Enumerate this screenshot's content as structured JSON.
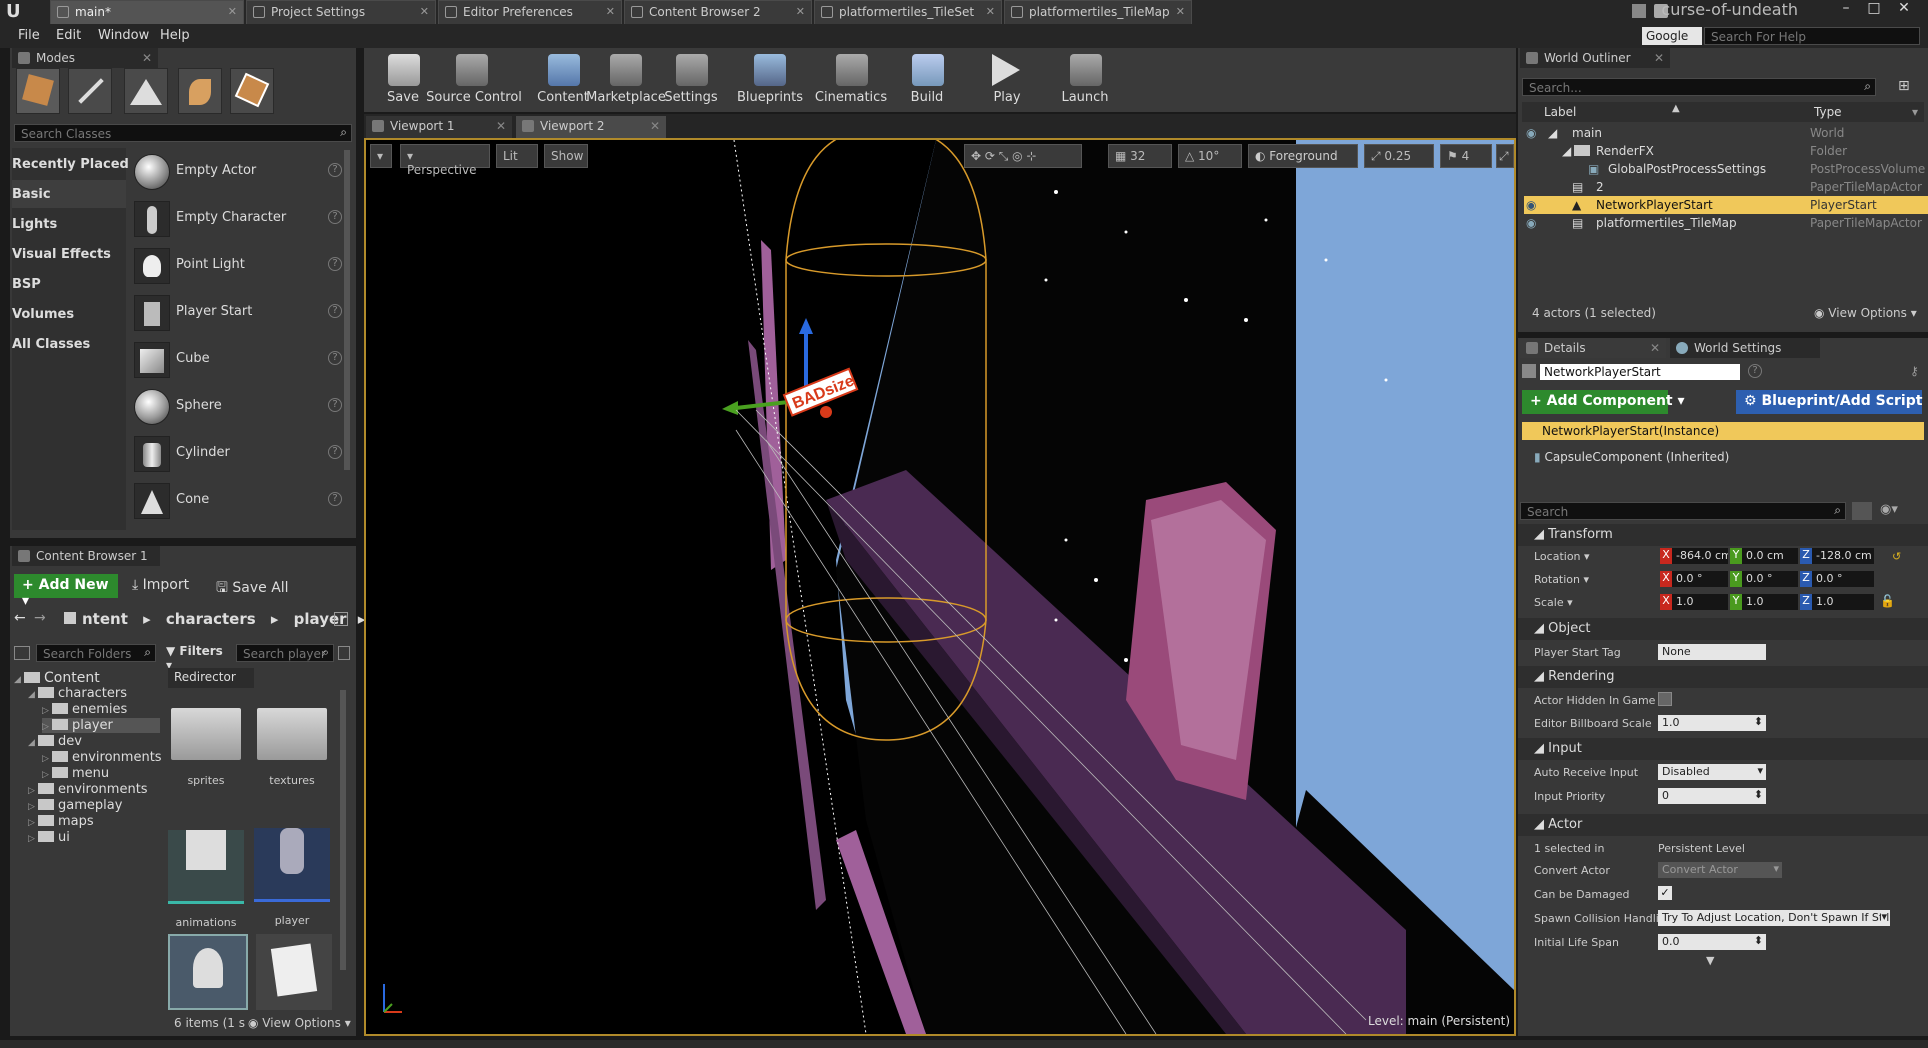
{
  "titlebar": {
    "tabs": [
      "main*",
      "Project Settings",
      "Editor Preferences",
      "Content Browser 2",
      "platformertiles_TileSet",
      "platformertiles_TileMap"
    ],
    "project_name": "curse-of-undeath"
  },
  "menubar": {
    "items": [
      "File",
      "Edit",
      "Window",
      "Help"
    ],
    "search_provider": "Google",
    "search_placeholder": "Search For Help"
  },
  "modes": {
    "panel_title": "Modes",
    "search_placeholder": "Search Classes",
    "categories": [
      "Recently Placed",
      "Basic",
      "Lights",
      "Visual Effects",
      "BSP",
      "Volumes",
      "All Classes"
    ],
    "classes": [
      "Empty Actor",
      "Empty Character",
      "Point Light",
      "Player Start",
      "Cube",
      "Sphere",
      "Cylinder",
      "Cone"
    ]
  },
  "toolbar": {
    "items": [
      "Save",
      "Source Control",
      "Content",
      "Marketplace",
      "Settings",
      "Blueprints",
      "Cinematics",
      "Build",
      "Play",
      "Launch"
    ]
  },
  "viewport": {
    "tabs": [
      "Viewport 1",
      "Viewport 2"
    ],
    "perspective": "Perspective",
    "lit": "Lit",
    "show": "Show",
    "grid_size": "32",
    "rotation_snap": "10°",
    "layer": "Foreground",
    "scale_snap": "0.25",
    "camera_speed": "4",
    "level_label": "Level:",
    "level_name": "main (Persistent)",
    "widget_label": "BADsize"
  },
  "content_browser": {
    "panel_title": "Content Browser 1",
    "add_new": "Add New",
    "import": "Import",
    "save_all": "Save All",
    "path": [
      "ntent",
      "characters",
      "player"
    ],
    "search_folders_placeholder": "Search Folders",
    "filters": "Filters",
    "search_placeholder": "Search player",
    "filter_chip": "Redirector",
    "tree": [
      {
        "label": "Content",
        "level": 0
      },
      {
        "label": "characters",
        "level": 1
      },
      {
        "label": "enemies",
        "level": 2
      },
      {
        "label": "player",
        "level": 2
      },
      {
        "label": "dev",
        "level": 1
      },
      {
        "label": "environments",
        "level": 2
      },
      {
        "label": "menu",
        "level": 2
      },
      {
        "label": "environments",
        "level": 1
      },
      {
        "label": "gameplay",
        "level": 1
      },
      {
        "label": "maps",
        "level": 1
      },
      {
        "label": "ui",
        "level": 1
      }
    ],
    "assets": [
      "sprites",
      "textures",
      "animations",
      "player"
    ],
    "item_count": "6 items (1 s",
    "view_options": "View Options"
  },
  "outliner": {
    "panel_title": "World Outliner",
    "search_placeholder": "Search...",
    "col_label": "Label",
    "col_type": "Type",
    "rows": [
      {
        "label": "main",
        "type": "World"
      },
      {
        "label": "RenderFX",
        "type": "Folder"
      },
      {
        "label": "GlobalPostProcessSettings",
        "type": "PostProcessVolume"
      },
      {
        "label": "2",
        "type": "PaperTileMapActor"
      },
      {
        "label": "NetworkPlayerStart",
        "type": "PlayerStart"
      },
      {
        "label": "platformertiles_TileMap",
        "type": "PaperTileMapActor"
      }
    ],
    "footer": "4 actors (1 selected)",
    "view_options": "View Options"
  },
  "details": {
    "tabs": [
      "Details",
      "World Settings"
    ],
    "actor_name": "NetworkPlayerStart",
    "add_component": "Add Component",
    "blueprint": "Blueprint/Add Script",
    "components": [
      "NetworkPlayerStart(Instance)",
      "CapsuleComponent (Inherited)"
    ],
    "search_placeholder": "Search",
    "sections": {
      "transform": "Transform",
      "object": "Object",
      "rendering": "Rendering",
      "input": "Input",
      "actor": "Actor"
    },
    "transform": {
      "location_label": "Location",
      "rotation_label": "Rotation",
      "scale_label": "Scale",
      "location": [
        "-864.0 cm",
        "0.0 cm",
        "-128.0 cm"
      ],
      "rotation": [
        "0.0 °",
        "0.0 °",
        "0.0 °"
      ],
      "scale": [
        "1.0",
        "1.0",
        "1.0"
      ]
    },
    "object": {
      "player_start_tag_label": "Player Start Tag",
      "player_start_tag": "None"
    },
    "rendering": {
      "hidden_label": "Actor Hidden In Game",
      "billboard_label": "Editor Billboard Scale",
      "billboard": "1.0"
    },
    "input": {
      "auto_receive_label": "Auto Receive Input",
      "auto_receive": "Disabled",
      "priority_label": "Input Priority",
      "priority": "0"
    },
    "actor": {
      "selected_in_label": "1 selected in",
      "selected_in": "Persistent Level",
      "convert_label": "Convert Actor",
      "convert": "Convert Actor",
      "damaged_label": "Can be Damaged",
      "spawn_label": "Spawn Collision Handlin",
      "spawn": "Try To Adjust Location, Don't Spawn If Stil",
      "life_label": "Initial Life Span",
      "life": "0.0"
    }
  },
  "colors": {
    "panel_bg": "#383838",
    "selection": "#f0c85a",
    "sky": "#7ea6d8",
    "accent_green": "#2d8a2d",
    "accent_blue": "#2d5fb0"
  }
}
